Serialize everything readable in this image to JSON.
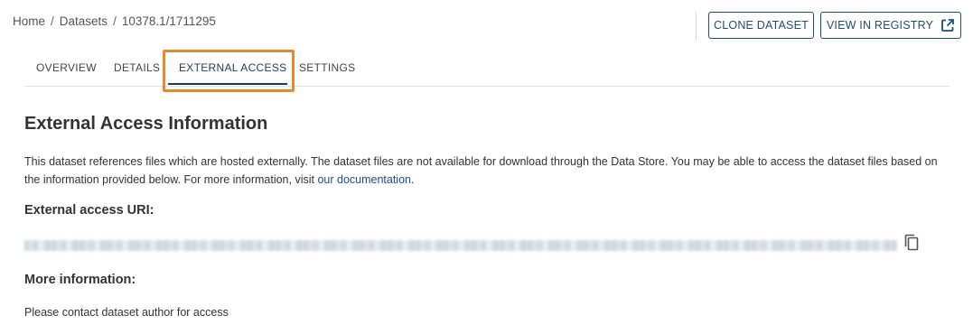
{
  "breadcrumb": {
    "items": [
      "Home",
      "Datasets",
      "10378.1/1711295"
    ],
    "separator": "/"
  },
  "actions": {
    "clone_label": "CLONE DATASET",
    "registry_label": "VIEW IN REGISTRY",
    "registry_icon": "open-in-new-icon"
  },
  "tabs": [
    {
      "label": "OVERVIEW",
      "active": false
    },
    {
      "label": "DETAILS",
      "active": false
    },
    {
      "label": "EXTERNAL ACCESS",
      "active": true
    },
    {
      "label": "SETTINGS",
      "active": false
    }
  ],
  "main": {
    "title": "External Access Information",
    "description_text": "This dataset references files which are hosted externally. The dataset files are not available for download through the Data Store. You may be able to access the dataset files based on the information provided below. For more information, visit ",
    "description_link": "our documentation",
    "description_end": ".",
    "uri_label": "External access URI:",
    "uri_value": "",
    "copy_icon": "copy-icon",
    "more_label": "More information:",
    "more_text": "Please contact dataset author for access"
  },
  "colors": {
    "primary": "#1f4e79",
    "highlight": "#e8892f",
    "link": "#1a4f85",
    "text": "#333333"
  }
}
